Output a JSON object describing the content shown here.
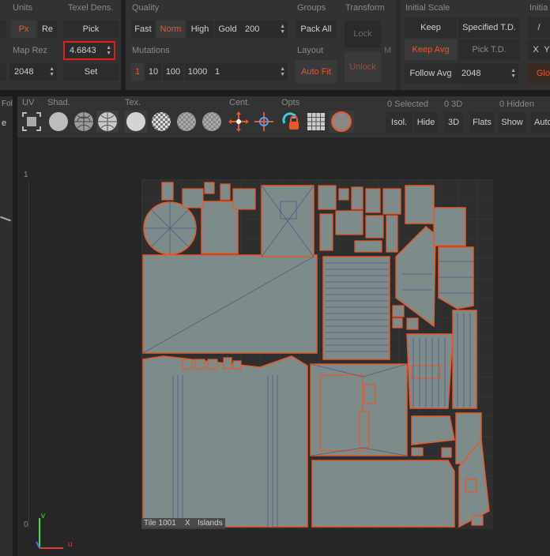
{
  "units": {
    "header": "Units",
    "px_label": "Px",
    "re_label": "Re",
    "maprez_header": "Map Rez",
    "maprez_value": "2048"
  },
  "texel": {
    "header": "Texel Dens.",
    "pick_label": "Pick",
    "value": "4.6843",
    "set_label": "Set"
  },
  "quality": {
    "header": "Quality",
    "fast": "Fast",
    "norm": "Norm",
    "high": "High",
    "gold": "Gold",
    "gold_value": "200"
  },
  "mutations": {
    "header": "Mutations",
    "opt1": "1",
    "opt10": "10",
    "opt100": "100",
    "opt1000": "1000",
    "value": "1"
  },
  "groups": {
    "header": "Groups",
    "pack_all": "Pack All",
    "layout_header": "Layout",
    "auto_fit": "Auto Fit"
  },
  "transform": {
    "header": "Transform",
    "lock": "Lock",
    "unlock": "Unlock",
    "m_label": "M"
  },
  "initial_scale": {
    "header": "Initial Scale",
    "keep": "Keep",
    "specified": "Specified T.D.",
    "keep_avg": "Keep Avg",
    "pick_td": "Pick T.D.",
    "follow_avg": "Follow Avg",
    "follow_value": "2048"
  },
  "initial_cut": {
    "header": "Initia",
    "slash": "/",
    "x_label": "X",
    "y_label": "Y",
    "glo": "Glo"
  },
  "toolbar": {
    "uv": "UV",
    "shad": "Shad.",
    "tex": "Tex.",
    "cent": "Cent.",
    "opts": "Opts",
    "left_fol": "Fol",
    "left_e": "e"
  },
  "selection": {
    "selected": "0 Selected",
    "three_d_count": "0 3D",
    "hidden": "0 Hidden",
    "isol": "Isol.",
    "hide": "Hide",
    "three_d": "3D",
    "flats": "Flats",
    "show": "Show",
    "auto": "Auto"
  },
  "viewport": {
    "ruler_top": "1",
    "ruler_bottom": "0",
    "axis_v": "v",
    "axis_u": "u",
    "tile": "Tile 1001",
    "x": "X",
    "islands": "Islands"
  },
  "colors": {
    "accent": "#e8582a",
    "island_fill": "#7d8b8a",
    "uv_bg": "#2e2e2e"
  }
}
